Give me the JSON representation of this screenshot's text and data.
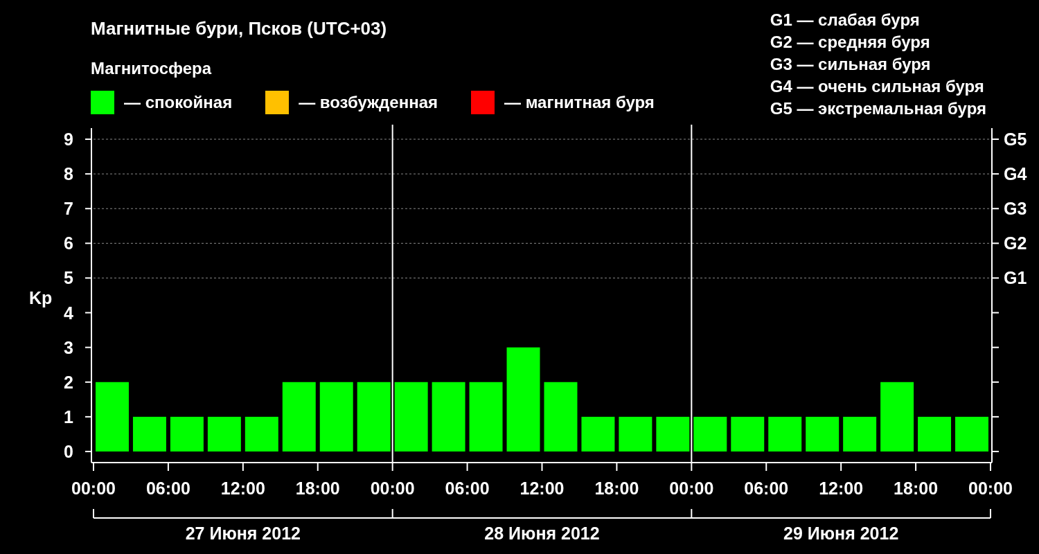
{
  "title": "Магнитные бури, Псков (UTC+03)",
  "legend_title": "Магнитосфера",
  "legend": [
    {
      "label": "— спокойная",
      "color": "#00ff00"
    },
    {
      "label": "— возбужденная",
      "color": "#ffc000"
    },
    {
      "label": "— магнитная буря",
      "color": "#ff0000"
    }
  ],
  "storm_scale": [
    "G1 — слабая буря",
    "G2 — средняя буря",
    "G3 — сильная буря",
    "G4 — очень сильная буря",
    "G5 — экстремальная буря"
  ],
  "chart_data": {
    "type": "bar",
    "ylabel": "Kp",
    "categories": [
      null,
      null,
      null,
      null,
      null,
      null,
      null,
      null,
      null,
      null,
      null,
      null,
      null,
      null,
      null,
      null,
      null,
      null,
      null,
      null,
      null,
      null,
      null,
      null
    ],
    "series": [
      {
        "color": "#00ff00",
        "values": [
          2,
          1,
          1,
          1,
          1,
          2,
          2,
          2,
          2,
          2,
          2,
          3,
          2,
          1,
          1,
          1,
          1,
          1,
          1,
          1,
          1,
          2,
          1,
          1
        ]
      }
    ],
    "ylim": [
      -0.32,
      9.32
    ],
    "yticks": [
      0,
      1,
      2,
      3,
      4,
      5,
      6,
      7,
      8,
      9
    ],
    "grid": true
  },
  "time_labels": [
    "00:00",
    "06:00",
    "12:00",
    "18:00",
    "00:00",
    "06:00",
    "12:00",
    "18:00",
    "00:00",
    "06:00",
    "12:00",
    "18:00",
    "00:00"
  ],
  "storm_levels": [
    "G5",
    "G4",
    "G3",
    "G2",
    "G1"
  ],
  "dates": [
    "27 Июня 2012",
    "28 Июня 2012",
    "29 Июня 2012"
  ]
}
